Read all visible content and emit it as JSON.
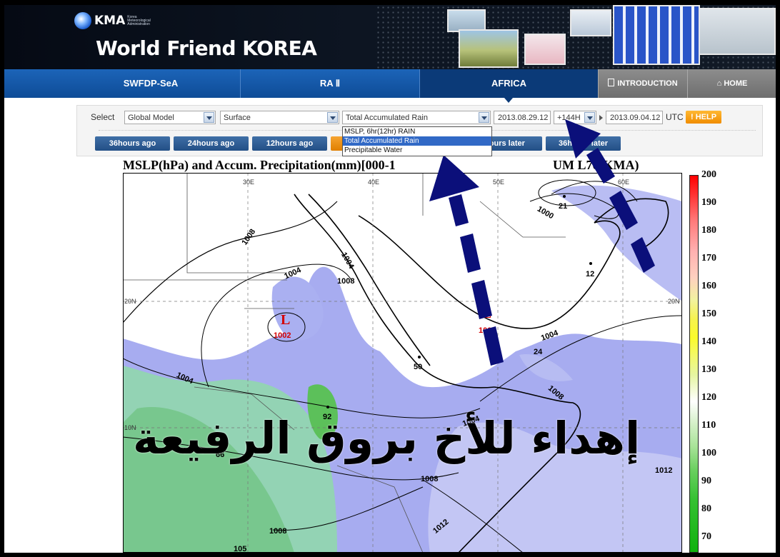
{
  "header": {
    "logo_text": "KMA",
    "logo_subtitle": "Korea Meteorological Administration",
    "site_title": "World Friend KOREA"
  },
  "nav": {
    "tabs": [
      {
        "label": "SWFDP-SeA"
      },
      {
        "label": "RA Ⅱ"
      },
      {
        "label": "AFRICA"
      }
    ],
    "introduction_label": "INTRODUCTION",
    "home_label": "HOME"
  },
  "controls": {
    "select_label": "Select",
    "model": "Global Model",
    "level": "Surface",
    "product": "Total Accumulated Rain",
    "product_options": [
      "MSLP, 6hr(12hr) RAIN",
      "Total Accumulated Rain",
      "Precipitable Water"
    ],
    "selected_option_index": 1,
    "init_date": "2013.08.29.12",
    "forecast_hour": "+144H",
    "valid_date": "2013.09.04.12",
    "utc_label": "UTC",
    "help_label": "! HELP",
    "time_buttons": [
      "36hours ago",
      "24hours ago",
      "12hours ago",
      "",
      "hours later",
      "36hours later"
    ]
  },
  "map": {
    "title": "MSLP(hPa) and Accum. Precipitation(mm)[000-1",
    "title_right": "UM       L70(KMA)",
    "lon_labels": [
      "30E",
      "40E",
      "50E",
      "60E"
    ],
    "lat_labels": [
      "20N",
      "10N",
      "20N"
    ],
    "isobar_labels": [
      "1008",
      "1004",
      "1004",
      "1000",
      "1004",
      "1004",
      "1008",
      "1004",
      "1008",
      "1008",
      "1012",
      "1008",
      "1012"
    ],
    "low_labels": [
      {
        "symbol": "L",
        "value": "1002"
      },
      {
        "symbol": "L",
        "value": "100"
      }
    ],
    "precip_values": [
      "21",
      "12",
      "24",
      "50",
      "92",
      "66",
      "105"
    ],
    "colorbar_labels": [
      "200",
      "190",
      "180",
      "170",
      "160",
      "150",
      "140",
      "130",
      "120",
      "110",
      "100",
      "90",
      "80",
      "70"
    ]
  },
  "overlay": {
    "arabic_text": "إهداء للأخ بروق الرفيعة",
    "arrow_color": "#0b0f7a"
  }
}
